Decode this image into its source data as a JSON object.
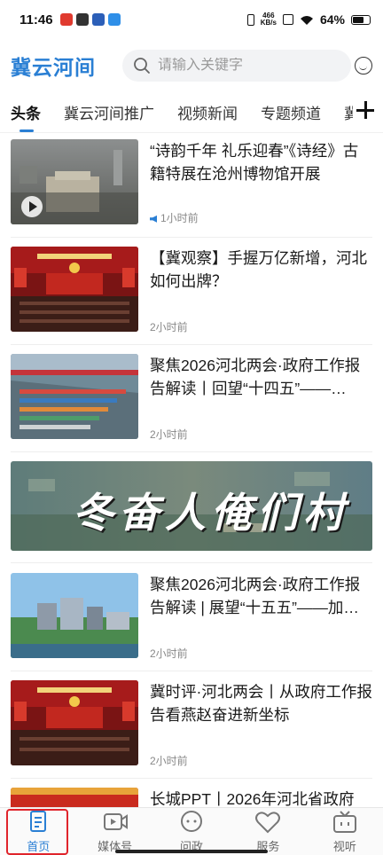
{
  "status_bar": {
    "time": "11:46",
    "net_speed_value": "466",
    "net_speed_unit": "KB/s",
    "battery": "64%"
  },
  "header": {
    "logo": "冀云河间",
    "search_placeholder": "请输入关键字"
  },
  "tabs": [
    "头条",
    "冀云河间推广",
    "视频新闻",
    "专题频道",
    "冀"
  ],
  "feed": [
    {
      "title": "“诗韵千年 礼乐迎春”《诗经》古籍特展在沧州博物馆开展",
      "time": "1小时前"
    },
    {
      "title": "【冀观察】手握万亿新增，河北如何出牌？",
      "time": "2小时前"
    },
    {
      "title": "聚焦2026河北两会·政府工作报告解读丨回望“十四五”——…",
      "time": "2小时前"
    },
    {
      "banner_text": "冬奋人俺们村"
    },
    {
      "title": "聚焦2026河北两会·政府工作报告解读 | 展望“十五五”——加…",
      "time": "2小时前"
    },
    {
      "title": "冀时评·河北两会丨从政府工作报告看燕赵奋进新坐标",
      "time": "2小时前"
    },
    {
      "title": "长城PPT丨2026年河北省政府"
    }
  ],
  "bottom_nav": [
    {
      "label": "首页",
      "icon": "home-doc-icon",
      "active": true
    },
    {
      "label": "媒体号",
      "icon": "video-icon",
      "active": false
    },
    {
      "label": "问政",
      "icon": "chat-bubble-icon",
      "active": false
    },
    {
      "label": "服务",
      "icon": "heart-icon",
      "active": false
    },
    {
      "label": "视听",
      "icon": "tv-icon",
      "active": false
    }
  ],
  "colors": {
    "accent": "#2a7fd4",
    "highlight": "#e0242b"
  }
}
